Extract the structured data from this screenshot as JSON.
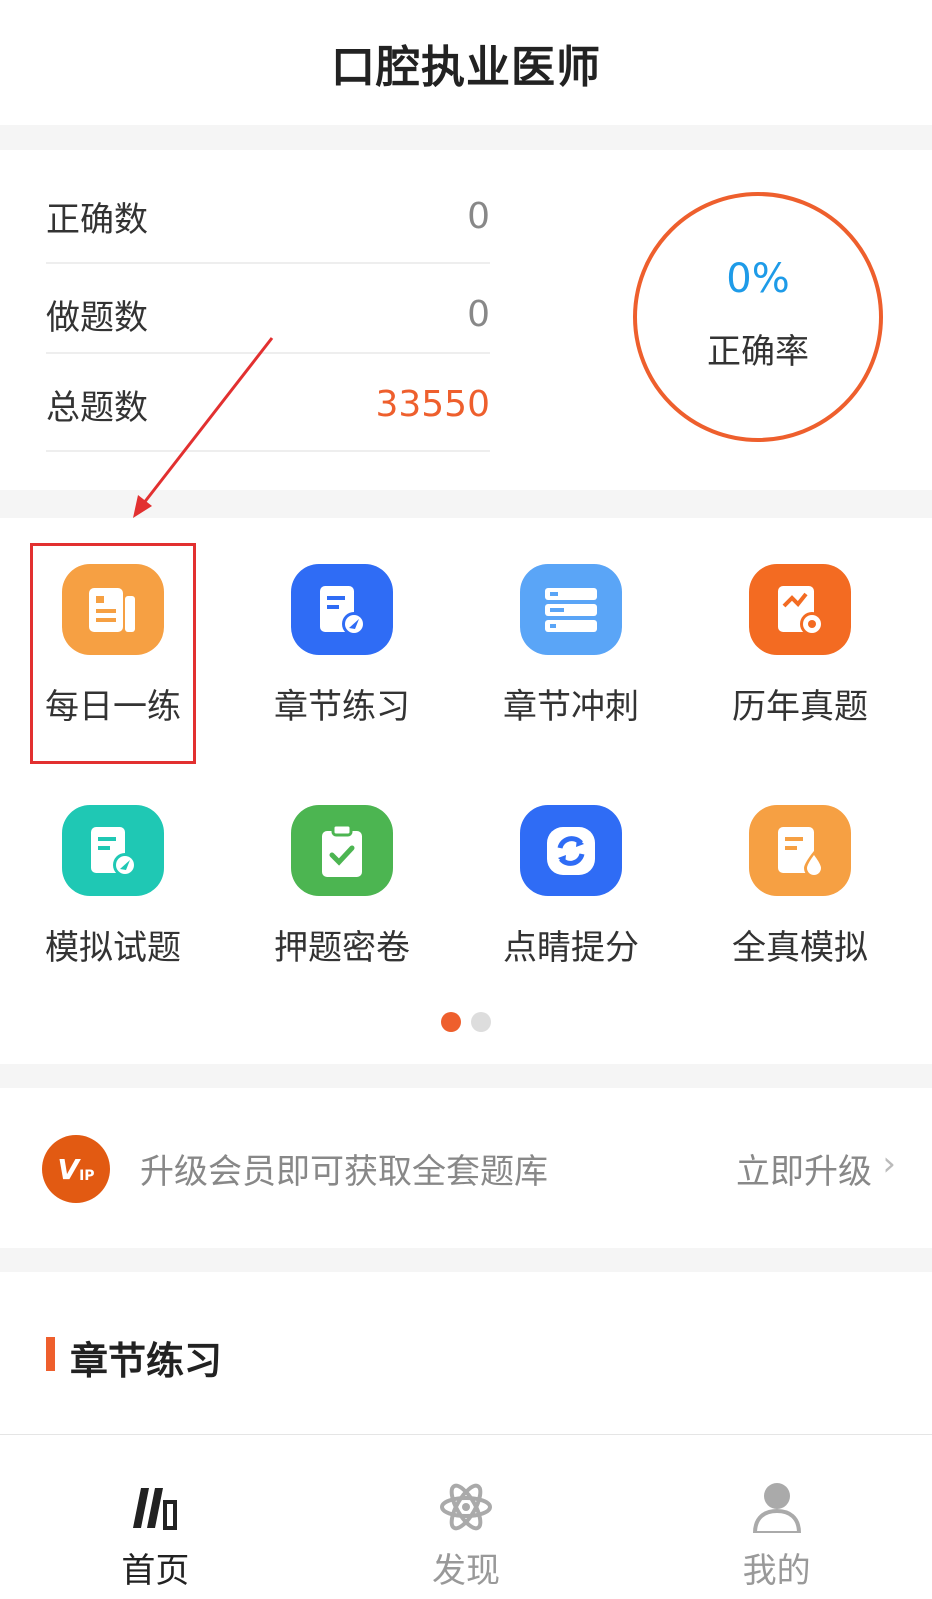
{
  "header": {
    "title": "口腔执业医师"
  },
  "stats": {
    "rows": [
      {
        "label": "正确数",
        "value": "0"
      },
      {
        "label": "做题数",
        "value": "0"
      },
      {
        "label": "总题数",
        "value": "33550"
      }
    ],
    "rate_value": "0%",
    "rate_label": "正确率"
  },
  "grid": {
    "items": [
      {
        "label": "每日一练",
        "icon": "daily-practice-icon",
        "color": "#f6a043"
      },
      {
        "label": "章节练习",
        "icon": "chapter-practice-icon",
        "color": "#2f6cf5"
      },
      {
        "label": "章节冲刺",
        "icon": "chapter-sprint-icon",
        "color": "#5aa5f7"
      },
      {
        "label": "历年真题",
        "icon": "past-exams-icon",
        "color": "#f36b22"
      },
      {
        "label": "模拟试题",
        "icon": "mock-questions-icon",
        "color": "#1fc8b4"
      },
      {
        "label": "押题密卷",
        "icon": "predicted-papers-icon",
        "color": "#4cb551"
      },
      {
        "label": "点睛提分",
        "icon": "score-boost-icon",
        "color": "#2f6cf5"
      },
      {
        "label": "全真模拟",
        "icon": "full-simulation-icon",
        "color": "#f6a043"
      }
    ],
    "page_count": 2,
    "active_page": 1
  },
  "vip": {
    "badge": "V",
    "badge_sub": "IP",
    "text": "升级会员即可获取全套题库",
    "action": "立即升级",
    "chevron": "›"
  },
  "section": {
    "title": "章节练习"
  },
  "tabbar": {
    "tabs": [
      {
        "label": "首页",
        "icon": "books-icon",
        "active": true
      },
      {
        "label": "发现",
        "icon": "atom-icon",
        "active": false
      },
      {
        "label": "我的",
        "icon": "person-icon",
        "active": false
      }
    ]
  },
  "colors": {
    "accent": "#ee5f2d",
    "rate": "#1e9be8",
    "highlight": "#e23030"
  }
}
